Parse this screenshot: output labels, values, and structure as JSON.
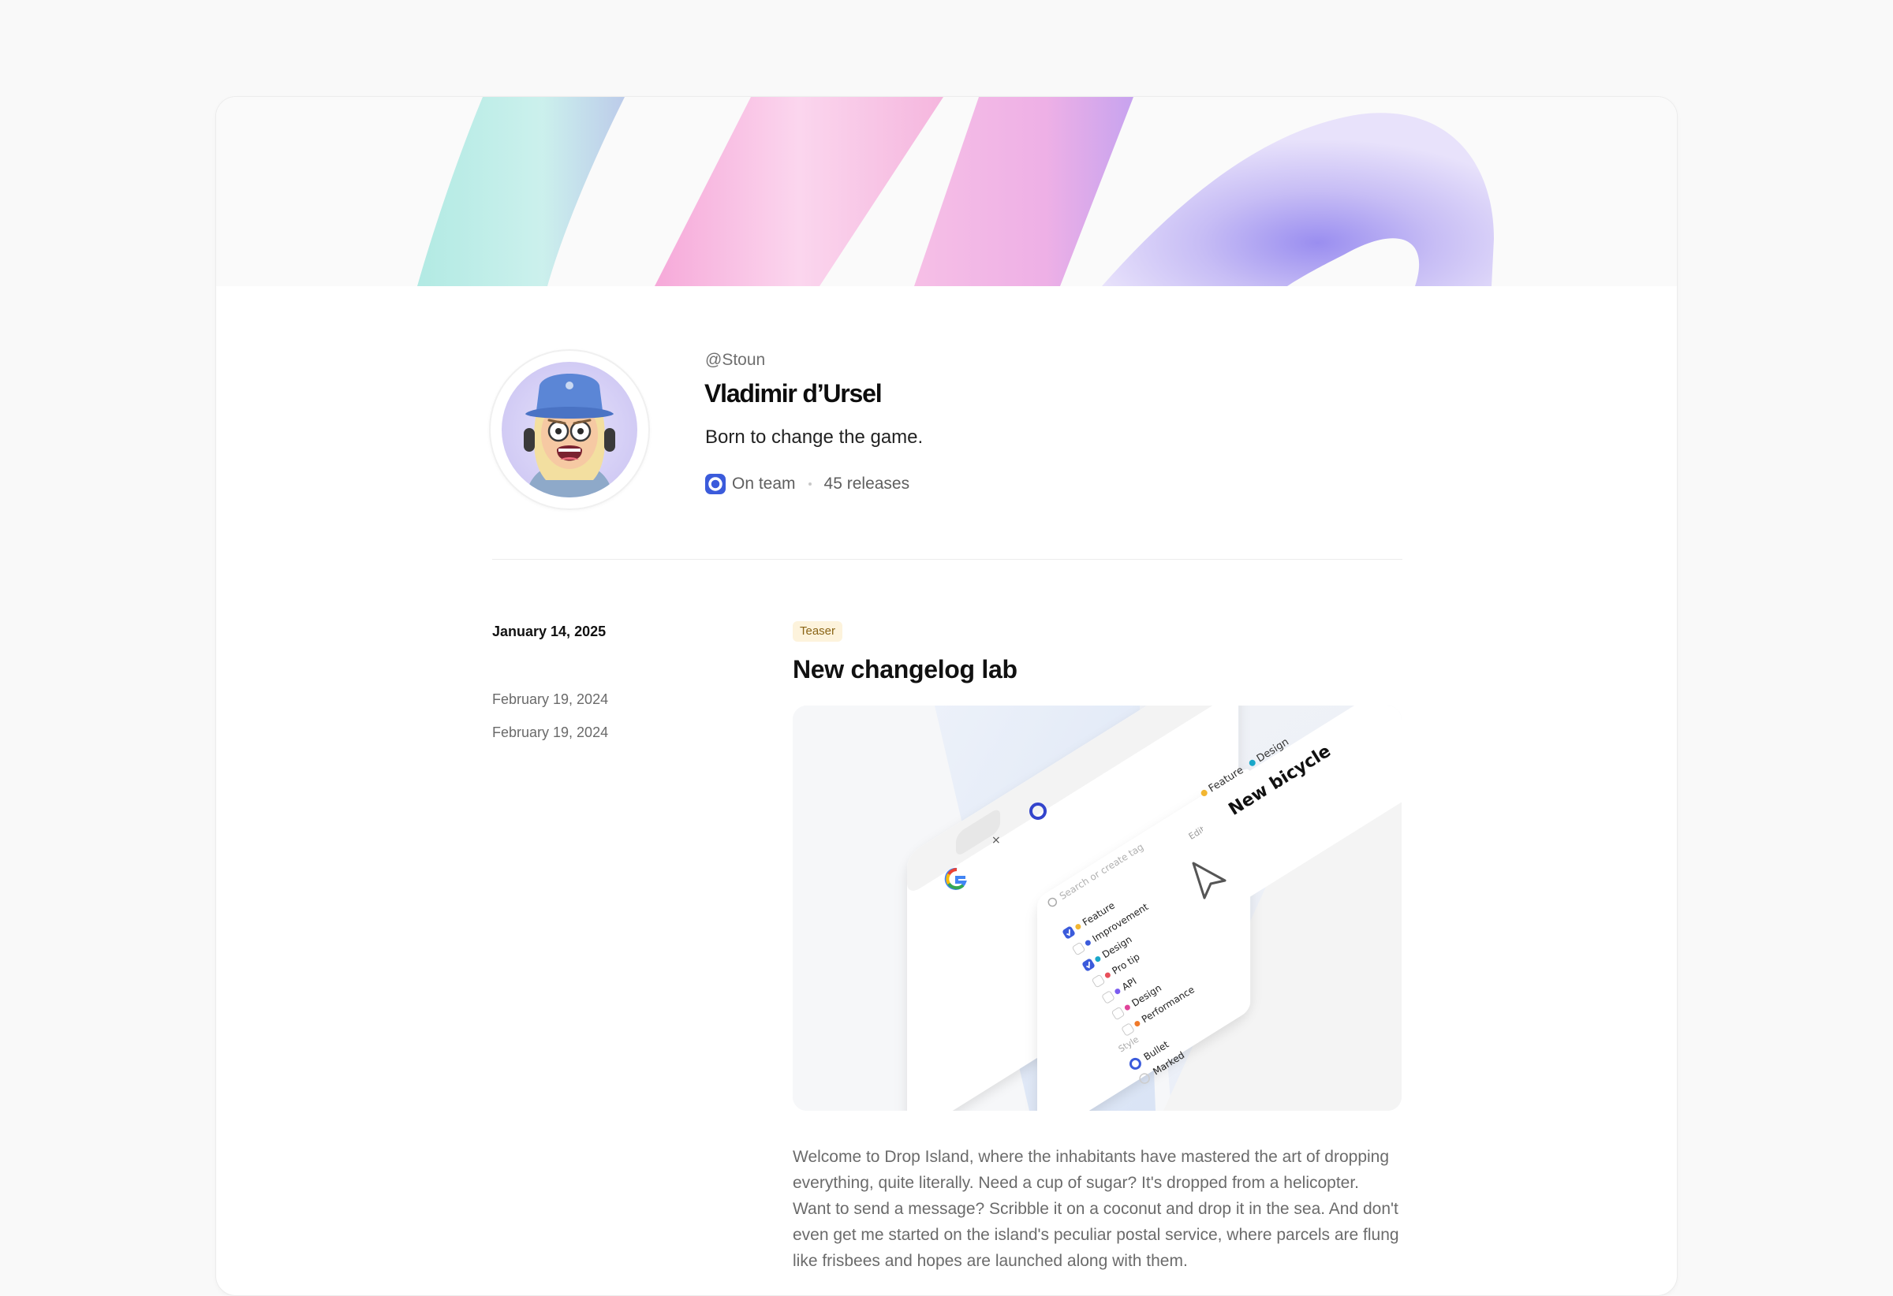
{
  "profile": {
    "handle": "@Stoun",
    "name": "Vladimir d’Ursel",
    "bio": "Born to change the game.",
    "team_label": "On team",
    "releases_label": "45 releases"
  },
  "timeline": {
    "dates": [
      "January 14, 2025",
      "February 19, 2024",
      "February 19, 2024"
    ]
  },
  "post": {
    "badge": "Teaser",
    "title": "New changelog lab",
    "body": "Welcome to Drop Island, where the inhabitants have mastered the art of dropping everything, quite literally. Need a cup of sugar? It's dropped from a helicopter. Want to send a message? Scribble it on a coconut and drop it in the sea. And don't even get me started on the island's peculiar postal service, where parcels are flung like frisbees and hopes are launched along with them."
  },
  "preview": {
    "close_symbol": "×",
    "search_placeholder": "Search or create tag",
    "edit_label": "Edit",
    "tags": [
      {
        "label": "Feature",
        "checked": true,
        "color": "#f2b632"
      },
      {
        "label": "Improvement",
        "checked": false,
        "color": "#3b5bdb"
      },
      {
        "label": "Design",
        "checked": true,
        "color": "#1aa7c9"
      },
      {
        "label": "Pro tip",
        "checked": false,
        "color": "#e8505b"
      },
      {
        "label": "API",
        "checked": false,
        "color": "#7b5cf0"
      },
      {
        "label": "Design",
        "checked": false,
        "color": "#e0449a"
      },
      {
        "label": "Performance",
        "checked": false,
        "color": "#f07a2a"
      }
    ],
    "style_label": "Style",
    "style_options": [
      "Bullet",
      "Marked"
    ],
    "card_tags": [
      {
        "label": "Feature",
        "color": "#f2b632"
      },
      {
        "label": "Design",
        "color": "#1aa7c9"
      }
    ],
    "card_title": "New bicycle"
  },
  "colors": {
    "accent": "#3b5bdb",
    "badge_bg": "#fdf3dc",
    "badge_text": "#8a6416"
  }
}
